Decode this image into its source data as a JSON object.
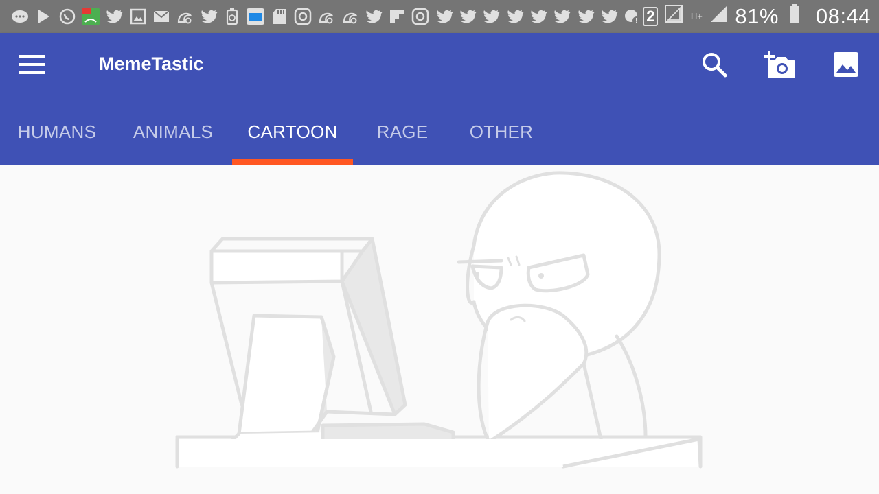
{
  "status_bar": {
    "notification_icons": [
      "messenger-icon",
      "play-store-icon",
      "whatsapp-icon",
      "app-icon",
      "twitter-icon",
      "gallery-icon",
      "email-icon",
      "uc-browser-icon",
      "twitter-icon",
      "recycle-icon",
      "book-icon",
      "sd-card-icon",
      "instagram-icon",
      "uc-browser-icon",
      "uc-browser-icon",
      "twitter-icon",
      "flipboard-icon",
      "instagram-icon",
      "twitter-icon",
      "twitter-icon",
      "twitter-icon",
      "twitter-icon",
      "twitter-icon",
      "twitter-icon",
      "twitter-icon",
      "alert-icon"
    ],
    "sim_slot": "2",
    "network_type": "H+",
    "battery_percent": "81%",
    "time": "08:44"
  },
  "toolbar": {
    "title": "MemeTastic",
    "background_color": "#3f51b5",
    "actions": [
      "search-icon",
      "add-photo-icon",
      "gallery-icon"
    ]
  },
  "tabs": {
    "items": [
      {
        "label": "HUMANS",
        "active": false
      },
      {
        "label": "ANIMALS",
        "active": false
      },
      {
        "label": "CARTOON",
        "active": true
      },
      {
        "label": "RAGE",
        "active": false
      },
      {
        "label": "OTHER",
        "active": false
      }
    ],
    "indicator_color": "#ff5722"
  },
  "content": {
    "image": "meme-computer-guy-image"
  }
}
